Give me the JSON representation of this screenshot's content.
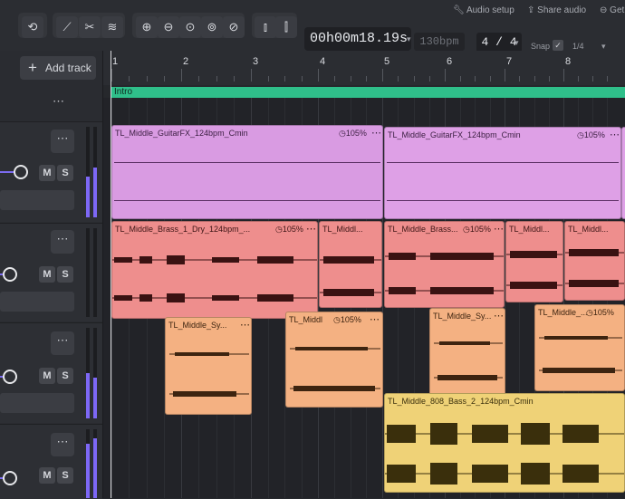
{
  "toolbar": {
    "time": "00h00m18.19s",
    "tempo": "130bpm",
    "signature": "4 / 4",
    "snap_label": "Snap",
    "grid_value": "1/4",
    "audio_setup": "Audio setup",
    "share_audio": "Share audio",
    "get_label": "Get"
  },
  "track_panel": {
    "add_track_label": "Add track",
    "mute_label": "M",
    "solo_label": "S",
    "more_label": "⋯",
    "tracks": [
      {
        "volume": 0.85,
        "meter": 0.65
      },
      {
        "volume": 0.4,
        "meter": 0.0
      },
      {
        "volume": 0.4,
        "meter": 0.75
      },
      {
        "volume": 0.4,
        "meter": 0.85
      }
    ]
  },
  "timeline": {
    "bars": [
      "1",
      "2",
      "3",
      "4",
      "5",
      "6",
      "7",
      "8"
    ],
    "marker": "Intro"
  },
  "clips": {
    "c1": {
      "name": "TL_Middle_GuitarFX_124bpm_Cmin",
      "speed": "105%"
    },
    "c2": {
      "name": "TL_Middle_GuitarFX_124bpm_Cmin",
      "speed": "105%"
    },
    "c3": {
      "name": "TL_Middle_Brass_1_Dry_124bpm_...",
      "speed": "105%"
    },
    "c4": {
      "name": "TL_Middl..."
    },
    "c5": {
      "name": "TL_Middle_Brass...",
      "speed": "105%"
    },
    "c6": {
      "name": "TL_Middl..."
    },
    "c7": {
      "name": "TL_Middl..."
    },
    "c8": {
      "name": "TL_Middle_Sy..."
    },
    "c9": {
      "name": "TL_Middl",
      "speed": "105%"
    },
    "c10": {
      "name": "TL_Middle_Sy..."
    },
    "c11": {
      "name": "TL_Middle_...",
      "speed": "105%"
    },
    "c12": {
      "name": "TL_Middle_808_Bass_2_124bpm_Cmin"
    }
  },
  "colors": {
    "accent": "#7d68f6",
    "marker": "#2fbf8a",
    "guitar": "#d79ae0",
    "brass": "#ef8f8f",
    "synth": "#f3b281",
    "bass": "#efd276"
  }
}
